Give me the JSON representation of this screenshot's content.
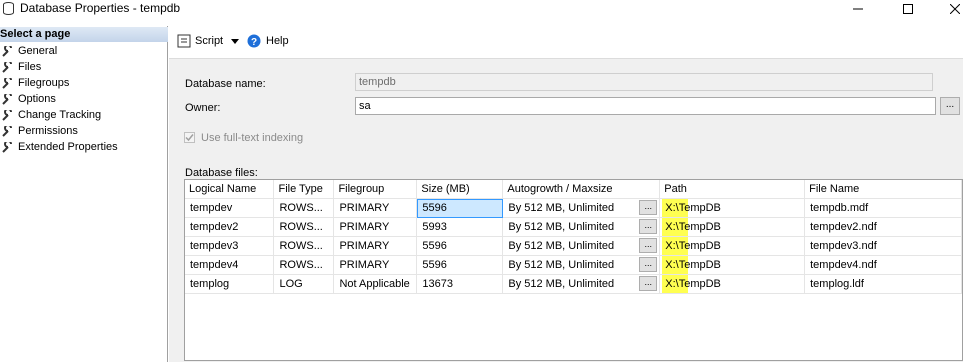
{
  "window": {
    "title": "Database Properties - tempdb"
  },
  "sidebar": {
    "header": "Select a page",
    "items": [
      {
        "label": "General"
      },
      {
        "label": "Files"
      },
      {
        "label": "Filegroups"
      },
      {
        "label": "Options"
      },
      {
        "label": "Change Tracking"
      },
      {
        "label": "Permissions"
      },
      {
        "label": "Extended Properties"
      }
    ]
  },
  "toolbar": {
    "script_label": "Script",
    "help_label": "Help"
  },
  "form": {
    "db_name_label": "Database name:",
    "db_name_value": "tempdb",
    "owner_label": "Owner:",
    "owner_value": "sa",
    "fulltext_label": "Use full-text indexing",
    "files_label": "Database files:",
    "browse_label": "..."
  },
  "grid": {
    "columns": [
      "Logical Name",
      "File Type",
      "Filegroup",
      "Size (MB)",
      "Autogrowth / Maxsize",
      "Path",
      "File Name"
    ],
    "rows": [
      [
        "tempdev",
        "ROWS...",
        "PRIMARY",
        "5596",
        "By 512 MB, Unlimited",
        "X:\\TempDB",
        "tempdb.mdf"
      ],
      [
        "tempdev2",
        "ROWS...",
        "PRIMARY",
        "5993",
        "By 512 MB, Unlimited",
        "X:\\TempDB",
        "tempdev2.ndf"
      ],
      [
        "tempdev3",
        "ROWS...",
        "PRIMARY",
        "5596",
        "By 512 MB, Unlimited",
        "X:\\TempDB",
        "tempdev3.ndf"
      ],
      [
        "tempdev4",
        "ROWS...",
        "PRIMARY",
        "5596",
        "By 512 MB, Unlimited",
        "X:\\TempDB",
        "tempdev4.ndf"
      ],
      [
        "templog",
        "LOG",
        "Not Applicable",
        "13673",
        "By 512 MB, Unlimited",
        "X:\\TempDB",
        "templog.ldf"
      ]
    ],
    "cell_button": "..."
  },
  "colors": {
    "highlight": "#ffff33",
    "selection": "#cde8ff",
    "help_icon": "#1e6fd9"
  }
}
